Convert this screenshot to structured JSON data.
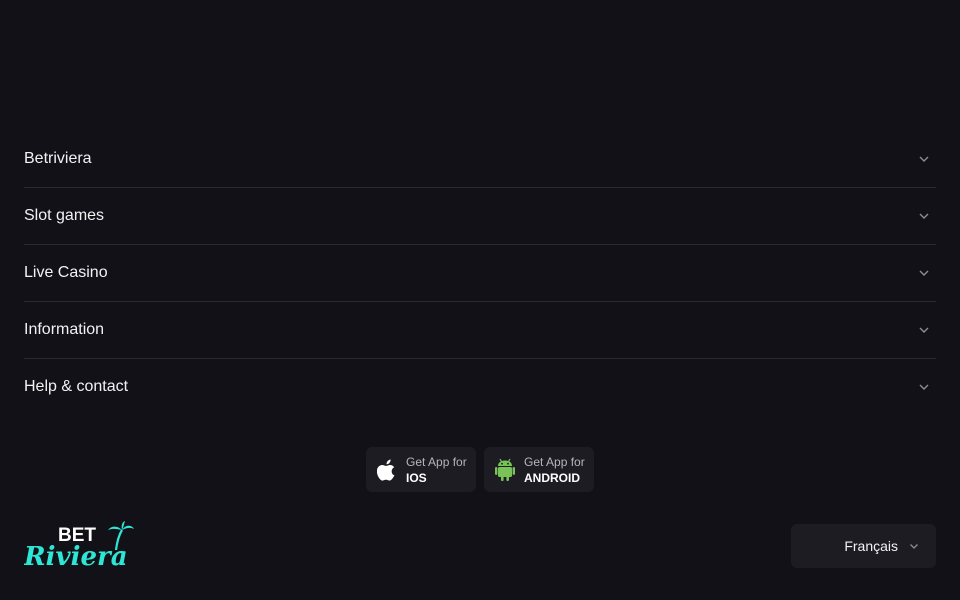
{
  "footer": {
    "menu": [
      {
        "label": "Betriviera"
      },
      {
        "label": "Slot games"
      },
      {
        "label": "Live Casino"
      },
      {
        "label": "Information"
      },
      {
        "label": "Help & contact"
      }
    ],
    "apps": {
      "ios": {
        "small": "Get App for",
        "big": "IOS",
        "icon": "apple-icon"
      },
      "android": {
        "small": "Get App for",
        "big": "ANDROID",
        "icon": "android-icon"
      }
    },
    "logo": {
      "top": "BET",
      "bottom": "Riviera",
      "icon": "palm-tree-icon"
    },
    "language": {
      "selected": "Français"
    }
  },
  "colors": {
    "background": "#121117",
    "panel": "#1d1c23",
    "divider": "#2a2a31",
    "accent": "#2ee6d6",
    "android": "#78c257"
  }
}
